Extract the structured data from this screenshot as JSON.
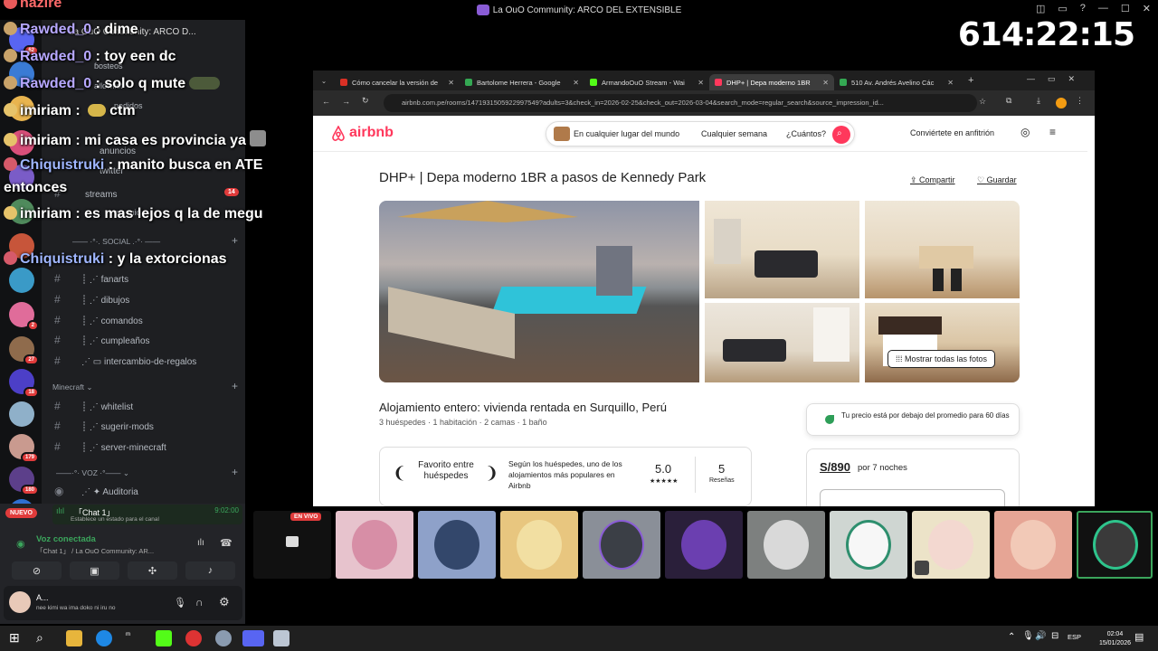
{
  "window": {
    "title": "La OuO Community: ARCO DEL EXTENSIBLE",
    "controls": [
      "◫",
      "▭",
      "?",
      "—",
      "☐",
      "✕"
    ]
  },
  "timer": "614:22:15",
  "chat": [
    {
      "name": "hazire",
      "sep": " : ",
      "text": ""
    },
    {
      "name": "Rawded_0",
      "sep": " : ",
      "text": "dime"
    },
    {
      "name": "Rawded_0",
      "sep": " : ",
      "text": "toy een dc"
    },
    {
      "name": "Rawded_0",
      "sep": " : ",
      "text": "solo q mute"
    },
    {
      "name": "imiriam",
      "sep": " : ",
      "text": "ctm"
    },
    {
      "name": "imiriam",
      "sep": " : ",
      "text": "mi casa es provincia ya"
    },
    {
      "name": "Chiquistruki",
      "sep": " : ",
      "text": "manito busca en ATE"
    },
    {
      "name": "",
      "sep": "",
      "text": "entonces"
    },
    {
      "name": "imiriam",
      "sep": " : ",
      "text": "es mas lejos q la de megu"
    },
    {
      "name": "Chiquistruki",
      "sep": " : ",
      "text": "y la extorcionas"
    }
  ],
  "server_badges": [
    "62",
    "2",
    "27",
    "18",
    "179",
    "180",
    "68"
  ],
  "channels": {
    "server_name": "La OuO Community: ARCO D...",
    "items": [
      {
        "label": "ɓosteos"
      },
      {
        "label": "allowlist"
      },
      {
        "label": "pedidos"
      },
      {
        "label": "anuncios"
      },
      {
        "label": "twitter"
      },
      {
        "label": "streams",
        "badge": "14"
      },
      {
        "label": "no_mic"
      }
    ],
    "social_cat": "SOCIAL",
    "social": [
      {
        "label": "fanarts"
      },
      {
        "label": "dibujos"
      },
      {
        "label": "comandos"
      },
      {
        "label": "cumpleaños"
      },
      {
        "label": "intercambio-de-regalos"
      }
    ],
    "mc_cat": "Minecraft",
    "minecraft": [
      {
        "label": "whitelist"
      },
      {
        "label": "sugerir-mods"
      },
      {
        "label": "server-minecraft"
      }
    ],
    "voz_cat": "VOZ",
    "voz": [
      {
        "label": "Auditoria"
      }
    ]
  },
  "voice": {
    "nuevo": "NUEVO",
    "stream_channel": "「Chat 1」",
    "stream_time": "9:02:00",
    "status_hint": "Establece un estado para el canal",
    "connected": "Voz conectada",
    "connected_sub": "「Chat 1」 / La OuO Community: AR...",
    "user_name": "A...",
    "user_status": "nee kimi wa ima doko ni iru no"
  },
  "browser": {
    "tabs": [
      {
        "label": "Cómo cancelar la versión de",
        "color": "#d93025"
      },
      {
        "label": "Bartolome Herrera - Google",
        "color": "#34a853"
      },
      {
        "label": "ArmandoOuO Stream - Wai",
        "color": "#53fc18"
      },
      {
        "label": "DHP+ | Depa moderno 1BR",
        "color": "#ff385c",
        "active": true
      },
      {
        "label": "510 Av. Andrés Avelino Các",
        "color": "#34a853"
      }
    ],
    "url": "airbnb.com.pe/rooms/1471931505922997549?adults=3&check_in=2026-02-25&check_out=2026-03-04&search_mode=regular_search&source_impression_id..."
  },
  "airbnb": {
    "logo": "airbnb",
    "search": {
      "where": "En cualquier lugar del mundo",
      "when": "Cualquier semana",
      "who": "¿Cuántos?"
    },
    "host": "Conviértete en anfitrión",
    "title": "DHP+ | Depa moderno 1BR a pasos de Kennedy Park",
    "share": "Compartir",
    "save": "Guardar",
    "show_photos": "Mostrar todas las fotos",
    "subtitle": "Alojamiento entero: vivienda rentada en Surquillo, Perú",
    "details": "3 huéspedes · 1 habitación · 2 camas · 1 baño",
    "fav_label": "Favorito entre huéspedes",
    "fav_desc": "Según los huéspedes, uno de los alojamientos más populares en Airbnb",
    "rating": "5.0",
    "stars": "★★★★★",
    "reviews": "5",
    "reviews_label": "Reseñas",
    "price_note": "Tu precio está por debajo del promedio para 60 días",
    "price": "S/890",
    "price_period": "por 7 noches"
  },
  "strip": {
    "live_label": "EN VIVO"
  },
  "taskbar": {
    "lang": "ESP",
    "time": "02:04",
    "date": "15/01/2026"
  },
  "colors": {
    "airbnb": "#ff385c",
    "discord_bg": "#1e1f22",
    "chat_name": "#b7a8ff"
  }
}
